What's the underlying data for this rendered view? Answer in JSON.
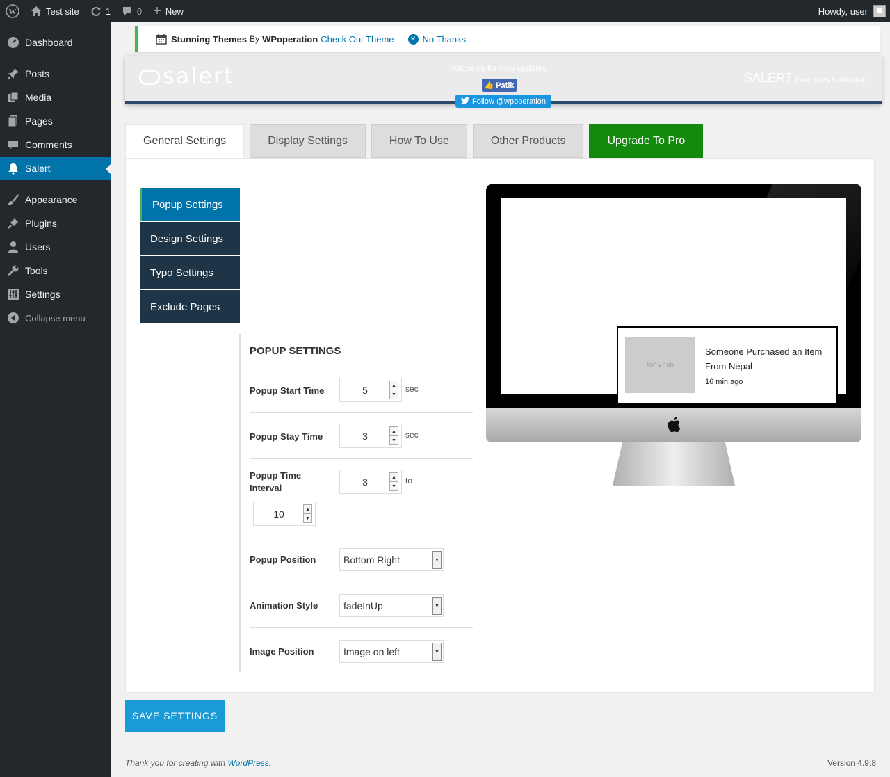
{
  "adminbar": {
    "site_name": "Test site",
    "updates_count": "1",
    "comments_count": "0",
    "new_label": "New",
    "howdy": "Howdy, user"
  },
  "sidebar": {
    "items": [
      {
        "label": "Dashboard",
        "icon": "dashboard-icon"
      },
      {
        "label": "Posts",
        "icon": "pin-icon"
      },
      {
        "label": "Media",
        "icon": "media-icon"
      },
      {
        "label": "Pages",
        "icon": "pages-icon"
      },
      {
        "label": "Comments",
        "icon": "comment-icon"
      },
      {
        "label": "Salert",
        "icon": "bell-icon",
        "active": true
      },
      {
        "label": "Appearance",
        "icon": "brush-icon"
      },
      {
        "label": "Plugins",
        "icon": "plug-icon"
      },
      {
        "label": "Users",
        "icon": "user-icon"
      },
      {
        "label": "Tools",
        "icon": "wrench-icon"
      },
      {
        "label": "Settings",
        "icon": "sliders-icon"
      }
    ],
    "collapse_label": "Collapse menu"
  },
  "notice": {
    "brand": "Stunning Themes",
    "by": "By",
    "author": "WPoperation",
    "check_link": "Check Out Theme",
    "no_thanks": "No Thanks"
  },
  "header": {
    "logo_text": "salert",
    "follow_text": "Follow us for new updates",
    "fb_label": "Patik",
    "twitter_label": "Follow @wpoperation",
    "product_name": "SALERT",
    "product_tagline": "Fake Sales Notification"
  },
  "tabs": [
    {
      "label": "General Settings",
      "active": true
    },
    {
      "label": "Display Settings"
    },
    {
      "label": "How To Use"
    },
    {
      "label": "Other Products"
    },
    {
      "label": "Upgrade To Pro",
      "accent": "#138a0e"
    }
  ],
  "subnav": [
    "Popup Settings",
    "Design Settings",
    "Typo Settings",
    "Exclude Pages"
  ],
  "form": {
    "title": "POPUP SETTINGS",
    "start_time": {
      "label": "Popup Start Time",
      "value": "5",
      "unit": "sec"
    },
    "stay_time": {
      "label": "Popup Stay Time",
      "value": "3",
      "unit": "sec"
    },
    "interval": {
      "label": "Popup Time Interval",
      "from": "3",
      "to_label": "to",
      "to": "10"
    },
    "position": {
      "label": "Popup Position",
      "value": "Bottom Right"
    },
    "animation": {
      "label": "Animation Style",
      "value": "fadeInUp"
    },
    "image_position": {
      "label": "Image Position",
      "value": "Image on left"
    }
  },
  "preview": {
    "image_placeholder": "100 x 100",
    "line1": "Someone Purchased an Item",
    "line2": "From Nepal",
    "ago": "16 min ago"
  },
  "save_label": "SAVE SETTINGS",
  "footer": {
    "thanks_prefix": "Thank you for creating with ",
    "wp_link": "WordPress",
    "thanks_suffix": ".",
    "version": "Version 4.9.8"
  }
}
